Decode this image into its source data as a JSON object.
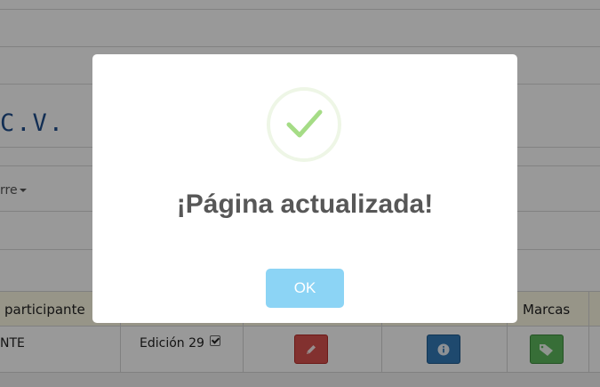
{
  "page": {
    "company_name": "C.V.",
    "dropdown_label": "rre"
  },
  "table": {
    "headers": [
      "participante",
      "Marcas"
    ],
    "row": {
      "participant": "NTE",
      "edition": "Edición 29",
      "edition_checked": true
    }
  },
  "actions": {
    "edit_icon": "pencil-icon",
    "info_icon": "info-icon",
    "brands_icon": "tag-icon"
  },
  "modal": {
    "title": "¡Página actualizada!",
    "ok_label": "OK",
    "icon": "success-check-icon"
  },
  "colors": {
    "overlay": "rgba(0,0,0,0.4)",
    "ok_button": "#8cd4f5",
    "check": "#a5dc86",
    "edit_button": "#d9534f",
    "info_button": "#337ab7",
    "brands_button": "#5cb85c",
    "table_header": "#fcf8e3",
    "company_title": "#1f4e8c"
  }
}
